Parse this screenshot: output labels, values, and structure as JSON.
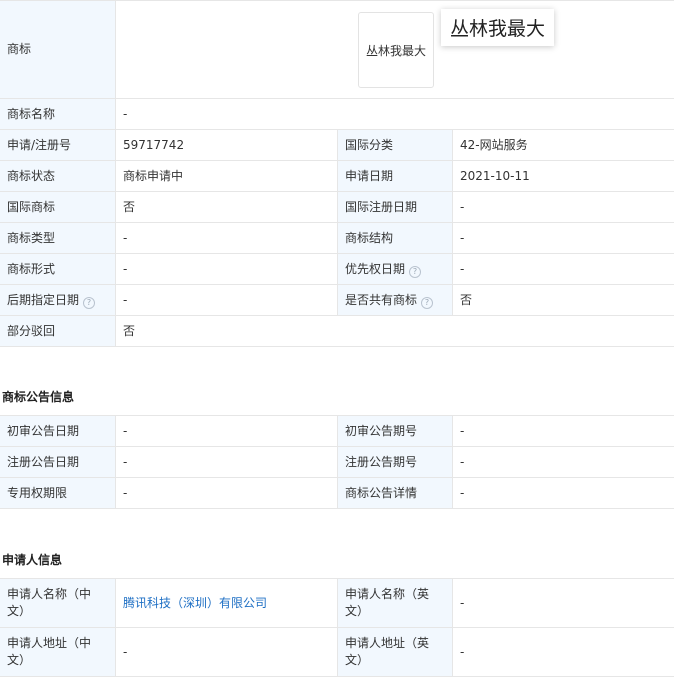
{
  "trademark": {
    "label": "商标",
    "logo_text": "丛林我最大",
    "tooltip_text": "丛林我最大"
  },
  "rows": {
    "name": {
      "label": "商标名称",
      "value": "-"
    },
    "reg_no": {
      "label": "申请/注册号",
      "value": "59717742"
    },
    "intl_class": {
      "label": "国际分类",
      "value": "42-网站服务"
    },
    "status": {
      "label": "商标状态",
      "value": "商标申请中"
    },
    "apply_date": {
      "label": "申请日期",
      "value": "2021-10-11"
    },
    "intl_mark": {
      "label": "国际商标",
      "value": "否"
    },
    "intl_reg_date": {
      "label": "国际注册日期",
      "value": "-"
    },
    "type": {
      "label": "商标类型",
      "value": "-"
    },
    "structure": {
      "label": "商标结构",
      "value": "-"
    },
    "form": {
      "label": "商标形式",
      "value": "-"
    },
    "priority_date": {
      "label": "优先权日期",
      "value": "-"
    },
    "later_date": {
      "label": "后期指定日期",
      "value": "-"
    },
    "shared": {
      "label": "是否共有商标",
      "value": "否"
    },
    "partial_reject": {
      "label": "部分驳回",
      "value": "否"
    }
  },
  "announcement": {
    "title": "商标公告信息",
    "first_date": {
      "label": "初审公告日期",
      "value": "-"
    },
    "first_no": {
      "label": "初审公告期号",
      "value": "-"
    },
    "reg_date": {
      "label": "注册公告日期",
      "value": "-"
    },
    "reg_no": {
      "label": "注册公告期号",
      "value": "-"
    },
    "term": {
      "label": "专用权期限",
      "value": "-"
    },
    "detail": {
      "label": "商标公告详情",
      "value": "-"
    }
  },
  "applicant": {
    "title": "申请人信息",
    "name_cn": {
      "label_line1": "申请人名称（中",
      "label_line2": "文）",
      "value": "腾讯科技（深圳）有限公司"
    },
    "name_en": {
      "label_line1": "申请人名称（英",
      "label_line2": "文）",
      "value": "-"
    },
    "addr_cn": {
      "label_line1": "申请人地址（中",
      "label_line2": "文）",
      "value": "-"
    },
    "addr_en": {
      "label_line1": "申请人地址（英",
      "label_line2": "文）",
      "value": "-"
    }
  },
  "colors": {
    "label_bg": "#f2f8fe",
    "border": "#e6e6e6",
    "link": "#1e6fc4"
  },
  "icons": {
    "help": "question-circle-icon"
  }
}
